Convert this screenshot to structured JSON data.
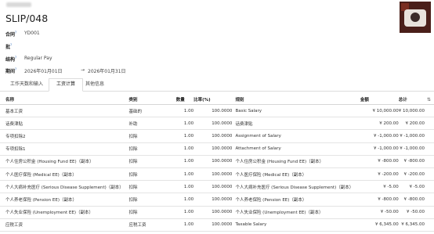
{
  "header": {
    "title": "SLIP/048"
  },
  "fields": {
    "contract_label": "合同",
    "contract_value": "YD001",
    "batch_label": "批",
    "batch_value": "",
    "structure_label": "结构",
    "structure_value": "Regular Pay",
    "period_label": "期间",
    "period_from": "2026年01月01日",
    "period_sep": "→",
    "period_to": "2026年01月31日"
  },
  "tabs": [
    {
      "label": "工作天数和输入"
    },
    {
      "label": "工资计算"
    },
    {
      "label": "其他信息"
    }
  ],
  "table": {
    "headers": {
      "name": "名称",
      "category": "类别",
      "quantity": "数量",
      "rate": "比率(%)",
      "rule": "规则",
      "amount": "金额",
      "total": "总计"
    },
    "rows": [
      {
        "name": "基本工资",
        "category": "基础的",
        "quantity": "1.00",
        "rate": "100.0000",
        "rule": "Basic Salary",
        "amount": "¥ 10,000.00",
        "total": "¥ 10,000.00"
      },
      {
        "name": "话费津贴",
        "category": "补助",
        "quantity": "1.00",
        "rate": "100.0000",
        "rule": "话费津贴",
        "amount": "¥ 200.00",
        "total": "¥ 200.00"
      },
      {
        "name": "专项扣除2",
        "category": "扣除",
        "quantity": "1.00",
        "rate": "100.0000",
        "rule": "Assignment of Salary",
        "amount": "¥ -1,000.00",
        "total": "¥ -1,000.00"
      },
      {
        "name": "专项扣除1",
        "category": "扣除",
        "quantity": "1.00",
        "rate": "100.0000",
        "rule": "Attachment of Salary",
        "amount": "¥ -1,000.00",
        "total": "¥ -1,000.00"
      },
      {
        "name": "个人住房公积金 (Housing Fund EE)（副本）",
        "category": "扣除",
        "quantity": "1.00",
        "rate": "100.0000",
        "rule": "个人住房公积金 (Housing Fund EE)（副本）",
        "amount": "¥ -800.00",
        "total": "¥ -800.00"
      },
      {
        "name": "个人医疗保险 (Medical EE)（副本）",
        "category": "扣除",
        "quantity": "1.00",
        "rate": "100.0000",
        "rule": "个人医疗保险 (Medical EE)（副本）",
        "amount": "¥ -200.00",
        "total": "¥ -200.00"
      },
      {
        "name": "个人大病补充医疗 (Serious Disease Supplement)（副本）",
        "category": "扣除",
        "quantity": "1.00",
        "rate": "100.0000",
        "rule": "个人大病补充医疗 (Serious Disease Supplement)（副本）",
        "amount": "¥ -5.00",
        "total": "¥ -5.00"
      },
      {
        "name": "个人养老保险 (Pension EE)（副本）",
        "category": "扣除",
        "quantity": "1.00",
        "rate": "100.0000",
        "rule": "个人养老保险 (Pension EE)（副本）",
        "amount": "¥ -800.00",
        "total": "¥ -800.00"
      },
      {
        "name": "个人失业保险 (Unemployment EE)（副本）",
        "category": "扣除",
        "quantity": "1.00",
        "rate": "100.0000",
        "rule": "个人失业保险 (Unemployment EE)（副本）",
        "amount": "¥ -50.00",
        "total": "¥ -50.00"
      },
      {
        "name": "应税工资",
        "category": "应税工资",
        "quantity": "1.00",
        "rate": "100.0000",
        "rule": "Taxable Salary",
        "amount": "¥ 6,345.00",
        "total": "¥ 6,345.00"
      }
    ]
  }
}
